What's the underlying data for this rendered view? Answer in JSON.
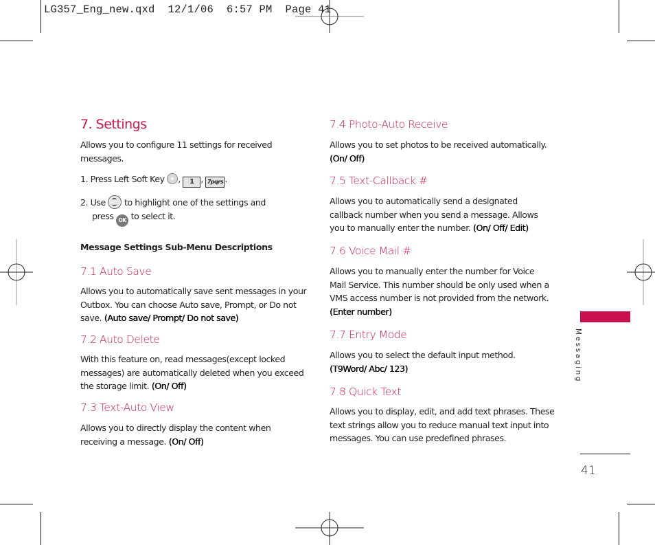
{
  "slug": "LG357_Eng_new.qxd  12/1/06  6:57 PM  Page 41",
  "accent_color": "#c8174f",
  "section": {
    "title": "7. Settings",
    "intro": "Allows you to configure 11 settings for received messages.",
    "steps": [
      {
        "prefix": "1. Press Left Soft Key",
        "key1_label": "1",
        "key2_label": "7pqrs",
        "sep": ",",
        "end": "."
      },
      {
        "prefix": "2. Use",
        "middle": "to highlight one of the settings and",
        "line2_prefix": "press",
        "ok_label": "OK",
        "line2_suffix": "to select it."
      }
    ],
    "sub_heading": "Message Settings Sub-Menu Descriptions"
  },
  "items": [
    {
      "title": "7.1 Auto Save",
      "text": "Allows you to automatically save sent messages in your Outbox. You can choose  Auto save, Prompt, or Do not save.",
      "options": "(Auto save/ Prompt/ Do not save)"
    },
    {
      "title": "7.2 Auto Delete",
      "text": "With this feature on, read messages(except locked messages) are automatically deleted when you exceed the storage limit.",
      "options": "(On/ Off)"
    },
    {
      "title": "7.3 Text-Auto View",
      "text": "Allows you to directly display the content when receiving a message.",
      "options": "(On/ Off)"
    },
    {
      "title": "7.4 Photo-Auto Receive",
      "text": "Allows you to set photos to be received automatically.",
      "options": "(On/ Off)"
    },
    {
      "title": "7.5 Text-Callback #",
      "text": "Allows you to automatically send a designated callback number when you send a message. Allows you to manually enter the number.",
      "options": "(On/ Off/ Edit)"
    },
    {
      "title": "7.6 Voice Mail #",
      "text": "Allows you to manually enter the number for Voice Mail Service. This number should be only used when a VMS access number is not provided from the network.",
      "options": "(Enter number)"
    },
    {
      "title": "7.7 Entry Mode",
      "text": "Allows you to select the default input method.",
      "options": "(T9Word/ Abc/ 123)"
    },
    {
      "title": "7.8 Quick Text",
      "text": "Allows you to display, edit, and add text phrases. These text strings allow you to reduce manual text input into messages. You can use predefined phrases.",
      "options": ""
    }
  ],
  "side_tab": {
    "label": "Messaging",
    "color": "#c8104d"
  },
  "page_number": "41"
}
